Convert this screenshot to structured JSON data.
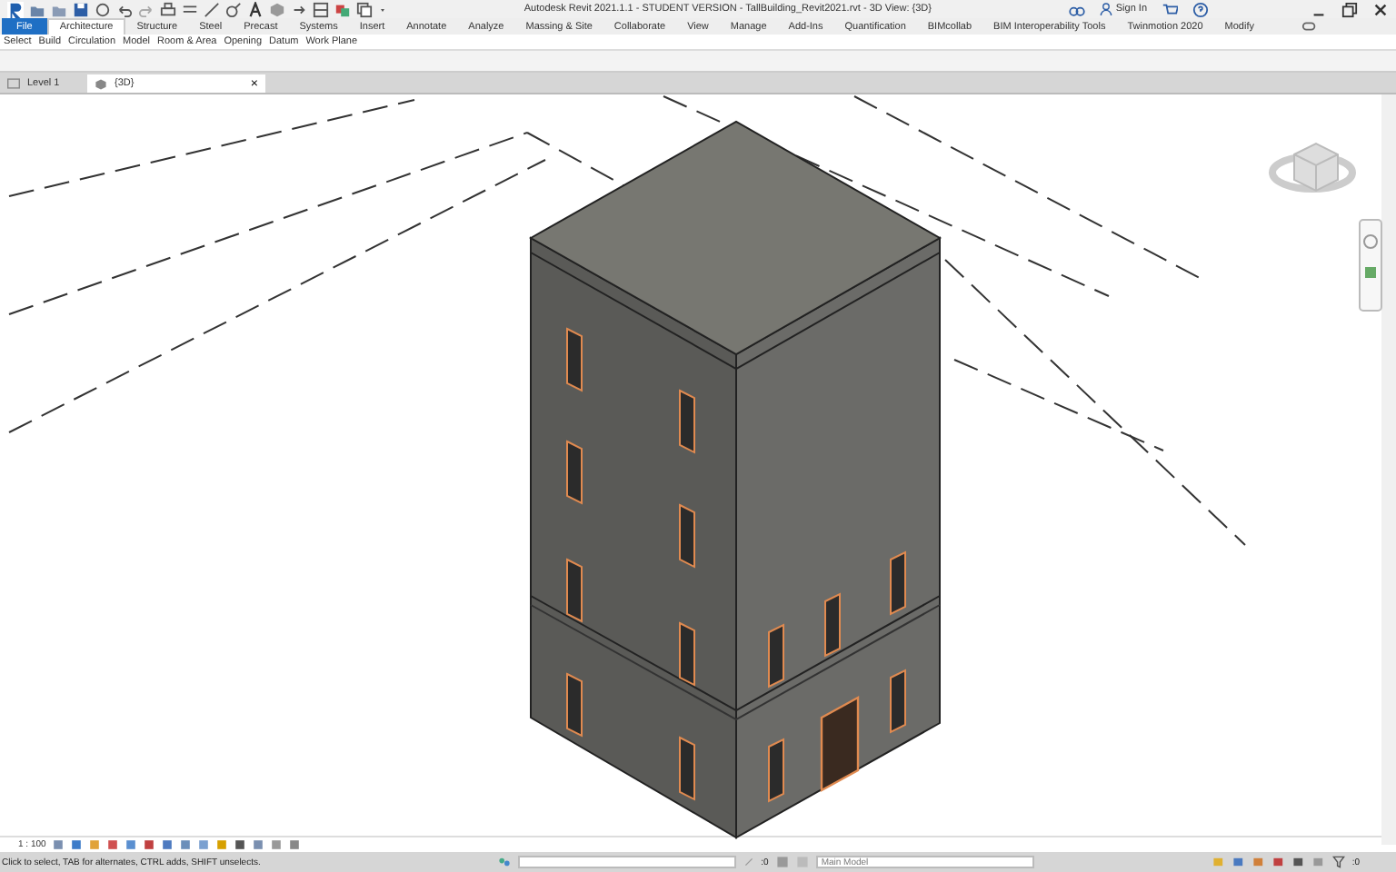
{
  "window": {
    "title": "Autodesk Revit 2021.1.1 - STUDENT VERSION - TallBuilding_Revit2021.rvt - 3D View: {3D}",
    "sign_in": "Sign In"
  },
  "ribbon": {
    "tabs": [
      {
        "label": "File",
        "kind": "app",
        "selected": false
      },
      {
        "label": "Architecture",
        "kind": "tab",
        "selected": true
      },
      {
        "label": "Structure",
        "kind": "tab",
        "selected": false
      },
      {
        "label": "Steel",
        "kind": "tab",
        "selected": false
      },
      {
        "label": "Precast",
        "kind": "tab",
        "selected": false
      },
      {
        "label": "Systems",
        "kind": "tab",
        "selected": false
      },
      {
        "label": "Insert",
        "kind": "tab",
        "selected": false
      },
      {
        "label": "Annotate",
        "kind": "tab",
        "selected": false
      },
      {
        "label": "Analyze",
        "kind": "tab",
        "selected": false
      },
      {
        "label": "Massing & Site",
        "kind": "tab",
        "selected": false
      },
      {
        "label": "Collaborate",
        "kind": "tab",
        "selected": false
      },
      {
        "label": "View",
        "kind": "tab",
        "selected": false
      },
      {
        "label": "Manage",
        "kind": "tab",
        "selected": false
      },
      {
        "label": "Add-Ins",
        "kind": "tab",
        "selected": false
      },
      {
        "label": "Quantification",
        "kind": "tab",
        "selected": false
      },
      {
        "label": "BIMcollab",
        "kind": "tab",
        "selected": false
      },
      {
        "label": "BIM Interoperability Tools",
        "kind": "tab",
        "selected": false
      },
      {
        "label": "Twinmotion 2020",
        "kind": "tab",
        "selected": false
      },
      {
        "label": "Modify",
        "kind": "tab",
        "selected": false
      }
    ],
    "panels": [
      "Select",
      "Build",
      "Circulation",
      "Model",
      "Room & Area",
      "Opening",
      "Datum",
      "Work Plane"
    ]
  },
  "view_tabs": [
    {
      "label": "Level 1",
      "selected": false
    },
    {
      "label": "{3D}",
      "selected": true,
      "close": "×"
    }
  ],
  "view_control_bar": {
    "scale": "1 : 100"
  },
  "status_bar": {
    "message": "Click to select, TAB for alternates, CTRL adds, SHIFT unselects.",
    "link_count": ":0",
    "workset": "Main Model",
    "filter_count": ":0"
  }
}
